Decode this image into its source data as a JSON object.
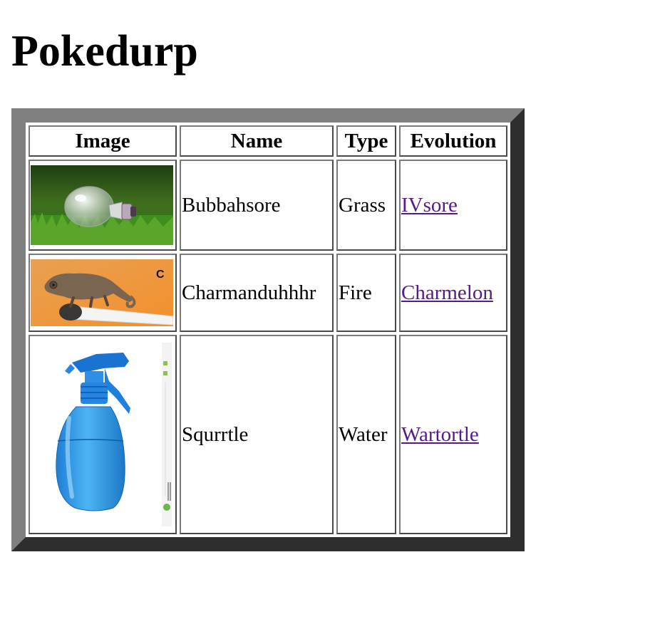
{
  "page": {
    "title": "Pokedurp"
  },
  "table": {
    "headers": [
      "Image",
      "Name",
      "Type",
      "Evolution"
    ],
    "rows": [
      {
        "image": "lightbulb-on-grass-image",
        "name": "Bubbahsore",
        "type": "Grass",
        "evolution": "IVsore"
      },
      {
        "image": "chameleon-on-match-image",
        "name": "Charmanduhhhr",
        "type": "Fire",
        "evolution": "Charmelon"
      },
      {
        "image": "blue-spray-bottle-image",
        "name": "Squrrtle",
        "type": "Water",
        "evolution": "Wartortle"
      }
    ],
    "image_overlay_text": {
      "row2": "C"
    }
  },
  "colors": {
    "link_visited": "#551a8b",
    "frame_light": "#808080",
    "frame_dark": "#2e2e2e"
  }
}
